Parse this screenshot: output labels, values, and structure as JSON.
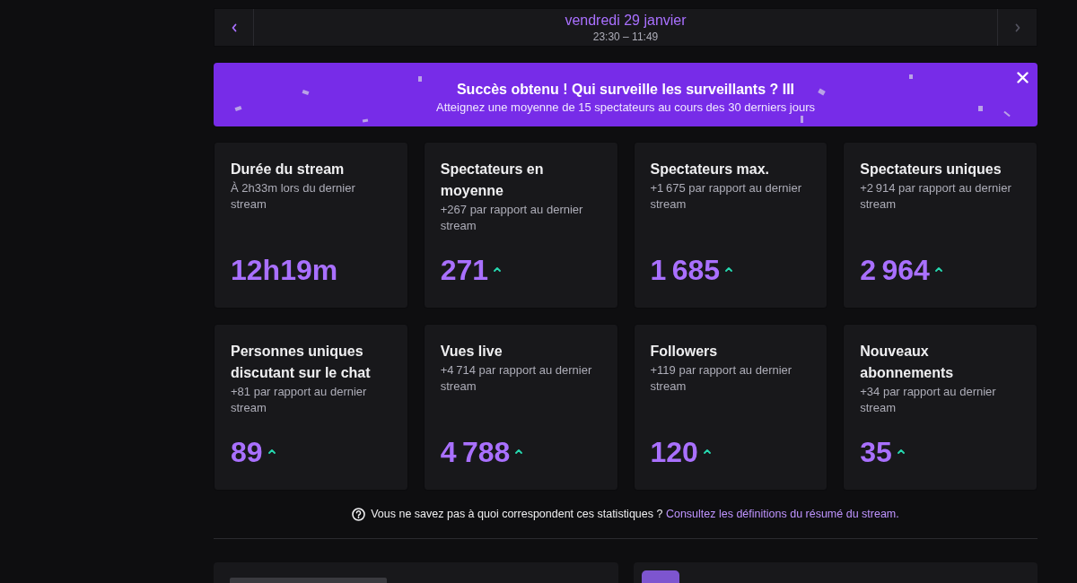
{
  "date_nav": {
    "previous": {
      "disabled": false
    },
    "date": "vendredi 29 janvier",
    "time_range": "23:30 – 11:49",
    "next": {
      "disabled": true
    }
  },
  "banner": {
    "title": "Succès obtenu ! Qui surveille les surveillants ? III",
    "subtitle": "Atteignez une moyenne de 15 spectateurs au cours des 30 derniers jours"
  },
  "stats": [
    {
      "title": "Durée du stream",
      "comparison": "À 2h33m lors du dernier stream",
      "value": "12h19m",
      "increased": false
    },
    {
      "title": "Spectateurs en moyenne",
      "comparison": "+267 par rapport au dernier stream",
      "value": "271",
      "increased": true
    },
    {
      "title": "Spectateurs max.",
      "comparison": "+1 675 par rapport au dernier stream",
      "value": "1 685",
      "increased": true
    },
    {
      "title": "Spectateurs uniques",
      "comparison": "+2 914 par rapport au dernier stream",
      "value": "2 964",
      "increased": true
    },
    {
      "title": "Personnes uniques discutant sur le chat",
      "comparison": "+81 par rapport au dernier stream",
      "value": "89",
      "increased": true
    },
    {
      "title": "Vues live",
      "comparison": "+4 714 par rapport au dernier stream",
      "value": "4 788",
      "increased": true
    },
    {
      "title": "Followers",
      "comparison": "+119 par rapport au dernier stream",
      "value": "120",
      "increased": true
    },
    {
      "title": "Nouveaux abonnements",
      "comparison": "+34 par rapport au dernier stream",
      "value": "35",
      "increased": true
    }
  ],
  "help": {
    "text": "Vous ne savez pas à quoi correspondent ces statistiques ?",
    "link": "Consultez les définitions du résumé du stream."
  }
}
